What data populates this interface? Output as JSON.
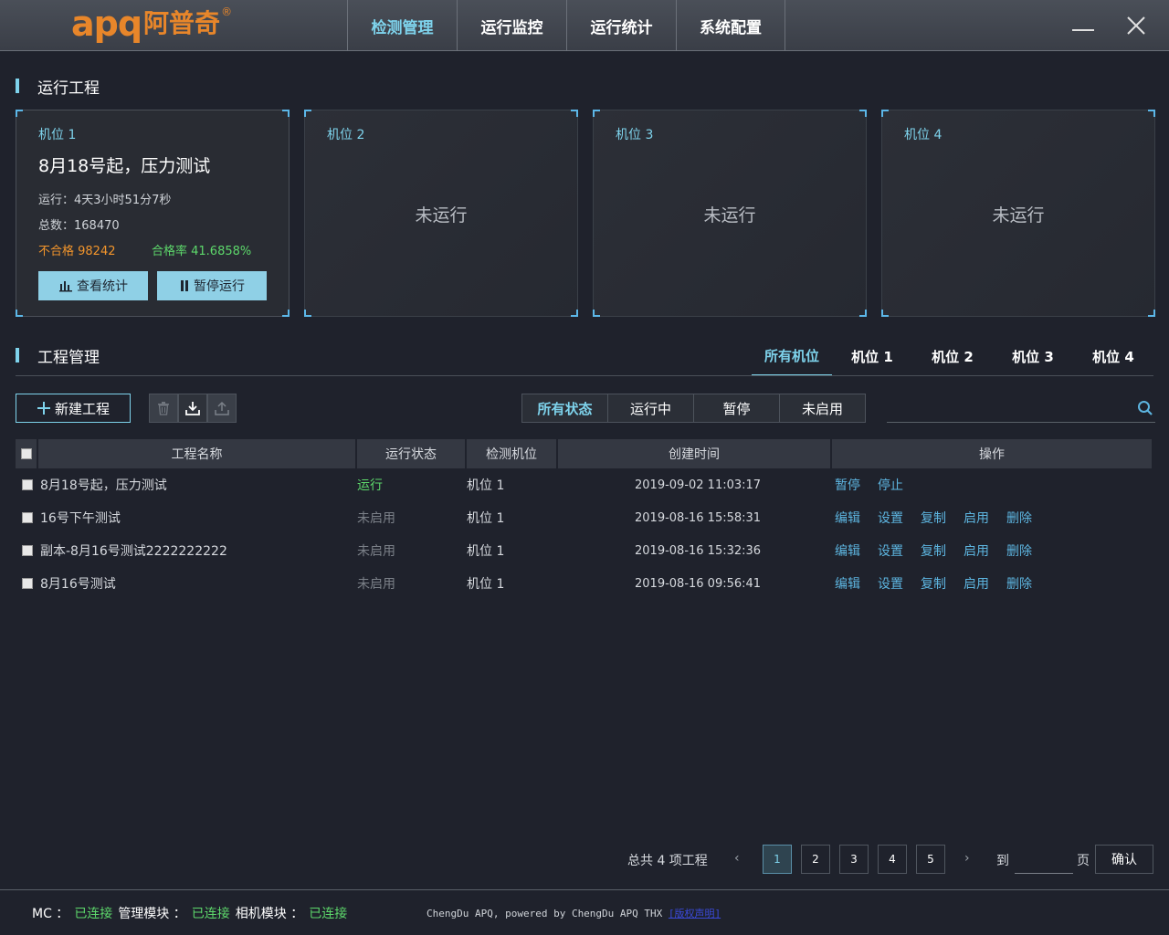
{
  "app": {
    "logo_latin": "apq",
    "logo_cn": "阿普奇",
    "logo_reg": "®",
    "nav": [
      {
        "label": "检测管理",
        "active": true
      },
      {
        "label": "运行监控",
        "active": false
      },
      {
        "label": "运行统计",
        "active": false
      },
      {
        "label": "系统配置",
        "active": false
      }
    ]
  },
  "running": {
    "title": "运行工程",
    "cards": [
      {
        "pos": "机位 1",
        "project": "8月18号起，压力测试",
        "runtime": "运行：4天3小时51分7秒",
        "total": "总数：168470",
        "fail": "不合格 98242",
        "rate": "合格率 41.6858%",
        "btn_stats": "查看统计",
        "btn_pause": "暂停运行"
      },
      {
        "pos": "机位 2",
        "state": "未运行"
      },
      {
        "pos": "机位 3",
        "state": "未运行"
      },
      {
        "pos": "机位 4",
        "state": "未运行"
      }
    ]
  },
  "manage": {
    "title": "工程管理",
    "pos_tabs": [
      "所有机位",
      "机位 1",
      "机位 2",
      "机位 3",
      "机位 4"
    ],
    "new_btn": "新建工程",
    "status_filters": [
      "所有状态",
      "运行中",
      "暂停",
      "未启用"
    ],
    "search_placeholder": "",
    "columns": [
      "工程名称",
      "运行状态",
      "检测机位",
      "创建时间",
      "操作"
    ],
    "rows": [
      {
        "name": "8月18号起，压力测试",
        "status": "运行",
        "pos": "机位 1",
        "created": "2019-09-02 11:03:17",
        "ops": [
          "暂停",
          "停止"
        ]
      },
      {
        "name": "16号下午测试",
        "status": "未启用",
        "pos": "机位 1",
        "created": "2019-08-16 15:58:31",
        "ops": [
          "编辑",
          "设置",
          "复制",
          "启用",
          "删除"
        ]
      },
      {
        "name": "副本-8月16号测试2222222222",
        "status": "未启用",
        "pos": "机位 1",
        "created": "2019-08-16 15:32:36",
        "ops": [
          "编辑",
          "设置",
          "复制",
          "启用",
          "删除"
        ]
      },
      {
        "name": "8月16号测试",
        "status": "未启用",
        "pos": "机位 1",
        "created": "2019-08-16 09:56:41",
        "ops": [
          "编辑",
          "设置",
          "复制",
          "启用",
          "删除"
        ]
      }
    ]
  },
  "pager": {
    "total": "总共 4 项工程",
    "prev": "‹",
    "next": "›",
    "pages": [
      "1",
      "2",
      "3",
      "4",
      "5"
    ],
    "current": "1",
    "goto": "到",
    "page_unit": "页",
    "confirm": "确认"
  },
  "footer": {
    "mc_label": "MC ：",
    "mc_state": "已连接",
    "mgmt_label": "管理模块 ：",
    "mgmt_state": "已连接",
    "cam_label": "相机模块 ：",
    "cam_state": "已连接",
    "copyright": "ChengDu APQ, powered by ChengDu APQ THX",
    "link": "[版权声明]"
  }
}
